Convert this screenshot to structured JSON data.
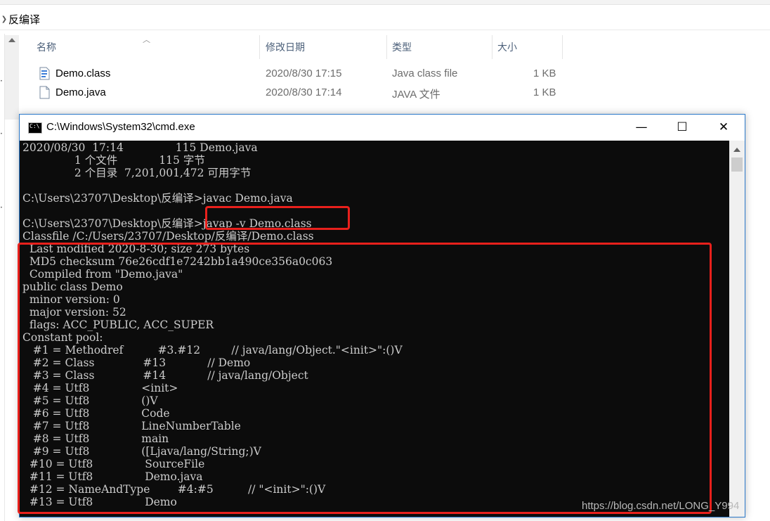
{
  "explorer": {
    "breadcrumb": "反编译",
    "columns": {
      "name": "名称",
      "date": "修改日期",
      "type": "类型",
      "size": "大小"
    },
    "files": [
      {
        "name": "Demo.class",
        "date": "2020/8/30 17:15",
        "type": "Java class file",
        "size": "1 KB"
      },
      {
        "name": "Demo.java",
        "date": "2020/8/30 17:14",
        "type": "JAVA 文件",
        "size": "1 KB"
      }
    ]
  },
  "cmd": {
    "title": "C:\\Windows\\System32\\cmd.exe",
    "buttons": {
      "minimize": "—",
      "maximize": "☐",
      "close": "✕"
    },
    "lines": [
      "2020/08/30  17:14               115 Demo.java",
      "               1 个文件            115 字节",
      "               2 个目录  7,201,001,472 可用字节",
      "",
      "C:\\Users\\23707\\Desktop\\反编译>javac Demo.java",
      "",
      "C:\\Users\\23707\\Desktop\\反编译>javap -v Demo.class",
      "Classfile /C:/Users/23707/Desktop/反编译/Demo.class",
      "  Last modified 2020-8-30; size 273 bytes",
      "  MD5 checksum 76e26cdf1e7242bb1a490ce356a0c063",
      "  Compiled from \"Demo.java\"",
      "public class Demo",
      "  minor version: 0",
      "  major version: 52",
      "  flags: ACC_PUBLIC, ACC_SUPER",
      "Constant pool:",
      "   #1 = Methodref          #3.#12         // java/lang/Object.\"<init>\":()V",
      "   #2 = Class              #13            // Demo",
      "   #3 = Class              #14            // java/lang/Object",
      "   #4 = Utf8               <init>",
      "   #5 = Utf8               ()V",
      "   #6 = Utf8               Code",
      "   #7 = Utf8               LineNumberTable",
      "   #8 = Utf8               main",
      "   #9 = Utf8               ([Ljava/lang/String;)V",
      "  #10 = Utf8               SourceFile",
      "  #11 = Utf8               Demo.java",
      "  #12 = NameAndType        #4:#5          // \"<init>\":()V",
      "  #13 = Utf8               Demo"
    ]
  },
  "watermark": "https://blog.csdn.net/LONG_Y⁠⁠994",
  "colors": {
    "annotation": "#e8201c",
    "console_bg": "#0c0c0c",
    "console_fg": "#cccccc"
  }
}
